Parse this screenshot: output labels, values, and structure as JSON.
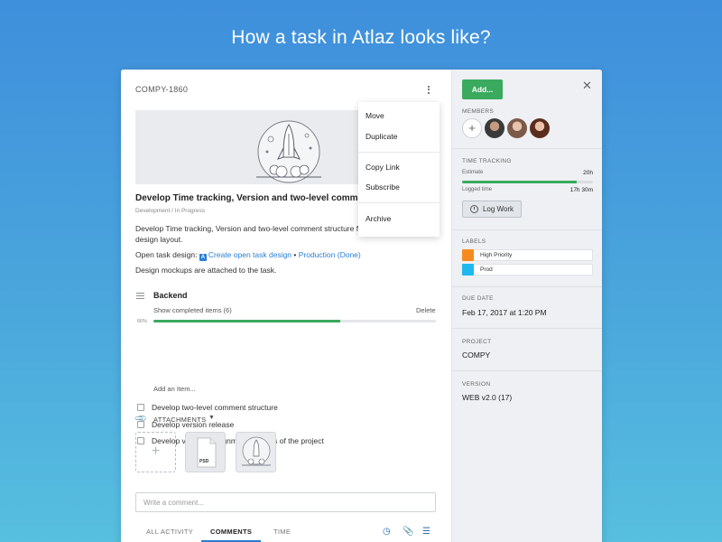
{
  "headline": "How a task in Atlaz looks like?",
  "task": {
    "id": "COMPY-1860",
    "title": "Develop Time tracking, Version and two-level comment structure",
    "meta": "Development / In Progress",
    "description_line1": "Develop Time tracking, Version and two-level comment structure from the",
    "description_line2": "design layout.",
    "open_design_prefix": "Open task design: ",
    "open_design_link": "Create open task design",
    "open_design_sep": " • ",
    "open_design_status": "Production (Done)",
    "description_line4": "Design mockups are attached to the task."
  },
  "menu": {
    "items": [
      "Move",
      "Duplicate",
      "Copy Link",
      "Subscribe",
      "Archive"
    ]
  },
  "checklist": {
    "title": "Backend",
    "show_completed": "Show completed items (6)",
    "delete": "Delete",
    "percent_label": "66%",
    "percent": 66,
    "items": [
      "Develop two-level comment structure",
      "Develop version release",
      "Develop version assignment in terms of the project"
    ],
    "add_item": "Add an Item..."
  },
  "attachments": {
    "label": "ATTACHMENTS",
    "add_symbol": "+",
    "psd_label": "PSD"
  },
  "comment": {
    "placeholder": "Write a comment..."
  },
  "tabs": {
    "all_activity": "ALL ACTIVITY",
    "comments": "COMMENTS",
    "time": "TIME"
  },
  "side": {
    "add_button": "Add...",
    "close_symbol": "✕",
    "members_label": "MEMBERS",
    "add_member_symbol": "+",
    "time_tracking_label": "TIME TRACKING",
    "estimate_label": "Estimate",
    "estimate_value": "20h",
    "logged_label": "Logged time",
    "logged_value": "17h 30m",
    "logged_fraction": 0.875,
    "log_work": "Log Work",
    "labels_label": "LABELS",
    "labels": [
      {
        "name": "High Priority",
        "color": "#f58b1f"
      },
      {
        "name": "Prod",
        "color": "#1fb8ee"
      }
    ],
    "due_date_label": "DUE DATE",
    "due_date": "Feb 17, 2017 at 1:20 PM",
    "project_label": "PROJECT",
    "project": "COMPY",
    "version_label": "VERSION",
    "version": "WEB v2.0 (17)"
  },
  "colors": {
    "accent_green": "#3aaa5e",
    "link_blue": "#2b7fd6",
    "background_top": "#3f8fdc",
    "background_bottom": "#57bfdf"
  }
}
